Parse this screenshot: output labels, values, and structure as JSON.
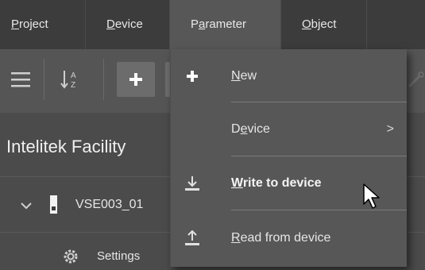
{
  "menubar": {
    "items": [
      {
        "pre": "",
        "u": "P",
        "post": "roject"
      },
      {
        "pre": "",
        "u": "D",
        "post": "evice"
      },
      {
        "pre": "P",
        "u": "a",
        "post": "rameter"
      },
      {
        "pre": "",
        "u": "O",
        "post": "bject"
      }
    ]
  },
  "toolbar": {
    "buttons": [
      "menu-icon",
      "sort-az-icon",
      "plus-icon"
    ]
  },
  "tree": {
    "facility": "Intelitek Facility",
    "device": "VSE003_01",
    "settings": "Settings"
  },
  "dropdown": {
    "items": [
      {
        "pre": "",
        "u": "N",
        "post": "ew",
        "icon": "plus-icon"
      },
      {
        "pre": "D",
        "u": "e",
        "post": "vice",
        "icon": "",
        "submenu_glyph": ">"
      },
      {
        "pre": "",
        "u": "W",
        "post": "rite to device",
        "icon": "download-icon",
        "bold": true
      },
      {
        "pre": "",
        "u": "R",
        "post": "ead from device",
        "icon": "upload-icon"
      }
    ]
  }
}
